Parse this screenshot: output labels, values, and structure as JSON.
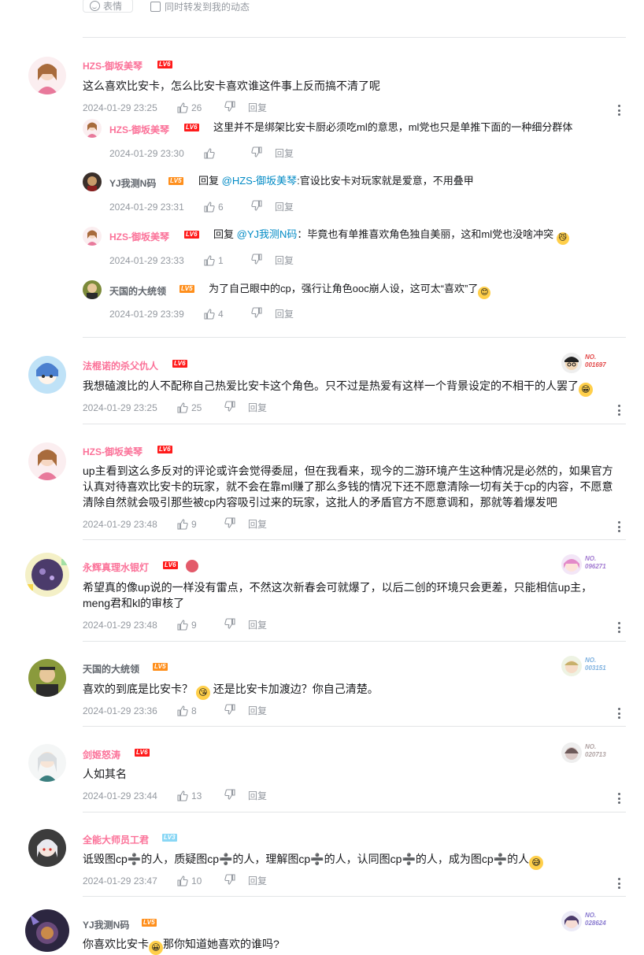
{
  "composer": {
    "emoji_label": "表情",
    "forward_label": "同时转发到我的动态"
  },
  "actions": {
    "reply": "回复",
    "reply_prefix": "回复"
  },
  "comments": [
    {
      "user": "HZS-御坂美琴",
      "level": "LV6",
      "text": "这么喜欢比安卡，怎么比安卡喜欢谁这件事上反而搞不清了呢",
      "time": "2024-01-29 23:25",
      "likes": "26",
      "replies": [
        {
          "user": "HZS-御坂美琴",
          "level": "LV6",
          "text": "这里并不是绑架比安卡厨必须吃ml的意思，ml党也只是单推下面的一种细分群体",
          "time": "2024-01-29 23:30",
          "likes": ""
        },
        {
          "user": "YJ我测N码",
          "level": "LV5",
          "mention": "@HZS-御坂美琴",
          "text": ":官设比安卡对玩家就是爱意，不用叠甲",
          "time": "2024-01-29 23:31",
          "likes": "6"
        },
        {
          "user": "HZS-御坂美琴",
          "level": "LV6",
          "mention": "@YJ我测N码",
          "text": "：毕竟也有单推喜欢角色独自美丽，这和ml党也没啥冲突",
          "time": "2024-01-29 23:33",
          "likes": "1"
        },
        {
          "user": "天国的大统领",
          "level": "LV5",
          "text": "为了自己眼中的cp，强行让角色ooc崩人设，这可太“喜欢”了",
          "time": "2024-01-29 23:39",
          "likes": "4"
        }
      ]
    },
    {
      "user": "法棍诺的杀父仇人",
      "level": "LV6",
      "text": "我想磕渡比的人不配称自己热爱比安卡这个角色。只不过是热爱有这样一个背景设定的不相干的人罢了",
      "time": "2024-01-29 23:25",
      "likes": "25",
      "fan_no": "NO.",
      "fan_num": "001697"
    },
    {
      "user": "HZS-御坂美琴",
      "level": "LV6",
      "text": "up主看到这么多反对的评论或许会觉得委屈，但在我看来，现今的二游环境产生这种情况是必然的，如果官方认真对待喜欢比安卡的玩家，就不会在靠ml赚了那么多钱的情况下还不愿意清除一切有关于cp的内容，不愿意清除自然就会吸引那些被cp内容吸引过来的玩家，这批人的矛盾官方不愿意调和，那就等着爆发吧",
      "time": "2024-01-29 23:48",
      "likes": "9"
    },
    {
      "user": "永辉真理水银灯",
      "level": "LV6",
      "text": "希望真的像up说的一样没有雷点，不然这次新春会可就爆了，以后二创的环境只会更差，只能相信up主，meng君和kl的审核了",
      "time": "2024-01-29 23:48",
      "likes": "9",
      "fan_no": "NO.",
      "fan_num": "096271"
    },
    {
      "user": "天国的大统领",
      "level": "LV5",
      "text_a": "喜欢的到底是比安卡？",
      "text_b": "还是比安卡加渡边？你自己清楚。",
      "time": "2024-01-29 23:36",
      "likes": "8",
      "fan_no": "NO.",
      "fan_num": "003151"
    },
    {
      "user": "剑姬怒涛",
      "level": "LV6",
      "text": "人如其名",
      "time": "2024-01-29 23:44",
      "likes": "13",
      "fan_no": "NO.",
      "fan_num": "020713"
    },
    {
      "user": "全能大师员工君",
      "level": "LV3",
      "text": "诋毁图cp➗的人，质疑图cp➗的人，理解图cp➗的人，认同图cp➗的人，成为图cp➗的人",
      "time": "2024-01-29 23:47",
      "likes": "10"
    },
    {
      "user": "YJ我测N码",
      "level": "LV5",
      "text_a": "你喜欢比安卡",
      "text_b": "那你知道她喜欢的谁吗?",
      "fan_no": "NO.",
      "fan_num": "028624"
    }
  ],
  "colors": {
    "username_pink": "#fb7299",
    "username_gray": "#61666d",
    "mention": "#008ac5",
    "meta": "#9499a0",
    "lv6": "#ff1b1b",
    "lv5": "#ff8f1c",
    "lv3": "#8ad7f5"
  }
}
